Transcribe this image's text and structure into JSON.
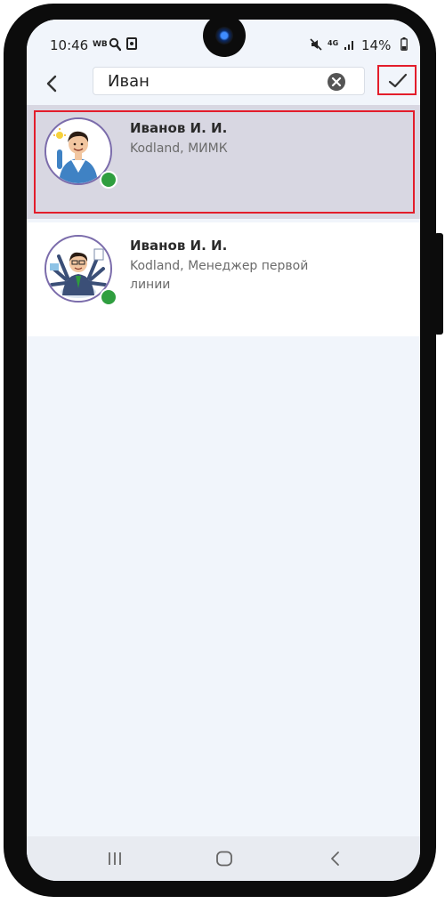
{
  "status_bar": {
    "time": "10:46",
    "carrier_tag": "WB",
    "network": "4G",
    "battery": "14%"
  },
  "toolbar": {
    "search": {
      "value": "Иван",
      "placeholder": ""
    }
  },
  "results": [
    {
      "name": "Иванов И. И.",
      "subtitle": "Kodland, МИМК",
      "avatar_icon": "person-idea-avatar-icon",
      "online": true,
      "selected": true
    },
    {
      "name": "Иванов И. И.",
      "subtitle": "Kodland, Менеджер первой линии",
      "avatar_icon": "multitask-manager-avatar-icon",
      "online": true,
      "selected": false
    }
  ],
  "colors": {
    "selected_row": "#d8d7e2",
    "highlight": "#e31d2b",
    "online": "#2f9e3f",
    "background": "#f1f5fb"
  }
}
